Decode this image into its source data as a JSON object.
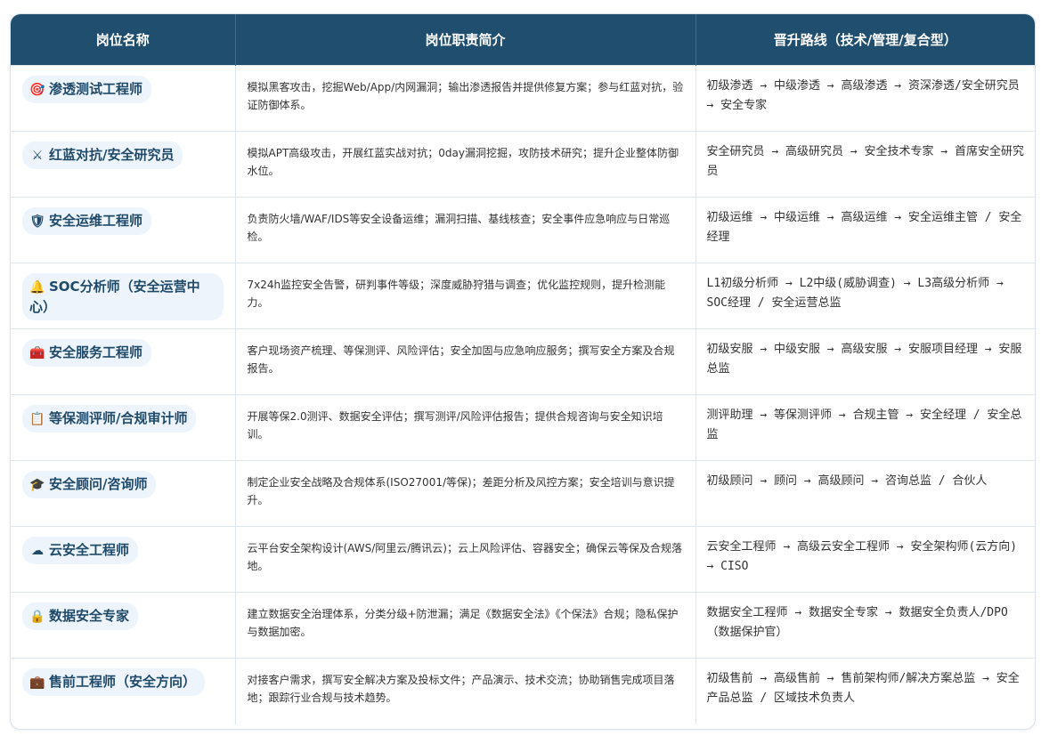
{
  "headers": {
    "col1": "岗位名称",
    "col2": "岗位职责简介",
    "col3": "晋升路线（技术/管理/复合型）"
  },
  "rows": [
    {
      "icon": "🎯",
      "icon_name": "target-icon",
      "name": "渗透测试工程师",
      "desc": "模拟黑客攻击，挖掘Web/App/内网漏洞；输出渗透报告并提供修复方案；参与红蓝对抗，验证防御体系。",
      "path": "初级渗透 → 中级渗透 → 高级渗透 → 资深渗透/安全研究员 → 安全专家"
    },
    {
      "icon": "⚔",
      "icon_name": "crossed-swords-icon",
      "name": "红蓝对抗/安全研究员",
      "desc": "模拟APT高级攻击，开展红蓝实战对抗；0day漏洞挖掘，攻防技术研究；提升企业整体防御水位。",
      "path": "安全研究员 → 高级研究员 → 安全技术专家 → 首席安全研究员"
    },
    {
      "icon": "🛡",
      "icon_name": "shield-icon",
      "name": "安全运维工程师",
      "desc": "负责防火墙/WAF/IDS等安全设备运维；漏洞扫描、基线核查；安全事件应急响应与日常巡检。",
      "path": "初级运维 → 中级运维 → 高级运维 → 安全运维主管 / 安全经理"
    },
    {
      "icon": "🔔",
      "icon_name": "alarm-icon",
      "name": "SOC分析师（安全运营中心）",
      "desc": "7x24h监控安全告警，研判事件等级；深度威胁狩猎与调查；优化监控规则，提升检测能力。",
      "path": "L1初级分析师 → L2中级(威胁调查) → L3高级分析师 → SOC经理 / 安全运营总监"
    },
    {
      "icon": "🧰",
      "icon_name": "toolbox-icon",
      "name": "安全服务工程师",
      "desc": "客户现场资产梳理、等保测评、风险评估；安全加固与应急响应服务；撰写安全方案及合规报告。",
      "path": "初级安服 → 中级安服 → 高级安服 → 安服项目经理 → 安服总监"
    },
    {
      "icon": "📋",
      "icon_name": "clipboard-icon",
      "name": "等保测评师/合规审计师",
      "desc": "开展等保2.0测评、数据安全评估；撰写测评/风险评估报告；提供合规咨询与安全知识培训。",
      "path": "测评助理 → 等保测评师 → 合规主管 → 安全经理 / 安全总监"
    },
    {
      "icon": "🎓",
      "icon_name": "graduation-cap-icon",
      "name": "安全顾问/咨询师",
      "desc": "制定企业安全战略及合规体系(ISO27001/等保)；差距分析及风控方案；安全培训与意识提升。",
      "path": "初级顾问 → 顾问 → 高级顾问 → 咨询总监 / 合伙人"
    },
    {
      "icon": "☁",
      "icon_name": "cloud-icon",
      "name": "云安全工程师",
      "desc": "云平台安全架构设计(AWS/阿里云/腾讯云)；云上风险评估、容器安全；确保云等保及合规落地。",
      "path": "云安全工程师 → 高级云安全工程师 → 安全架构师(云方向) → CISO"
    },
    {
      "icon": "🔒",
      "icon_name": "lock-icon",
      "name": "数据安全专家",
      "desc": "建立数据安全治理体系，分类分级+防泄漏；满足《数据安全法》《个保法》合规；隐私保护与数据加密。",
      "path": "数据安全工程师 → 数据安全专家 → 数据安全负责人/DPO（数据保护官）"
    },
    {
      "icon": "💼",
      "icon_name": "briefcase-icon",
      "name": "售前工程师（安全方向）",
      "desc": "对接客户需求，撰写安全解决方案及投标文件；产品演示、技术交流；协助销售完成项目落地；跟踪行业合规与技术趋势。",
      "path": "初级售前 → 高级售前 → 售前架构师/解决方案总监 → 安全产品总监 / 区域技术负责人"
    }
  ]
}
